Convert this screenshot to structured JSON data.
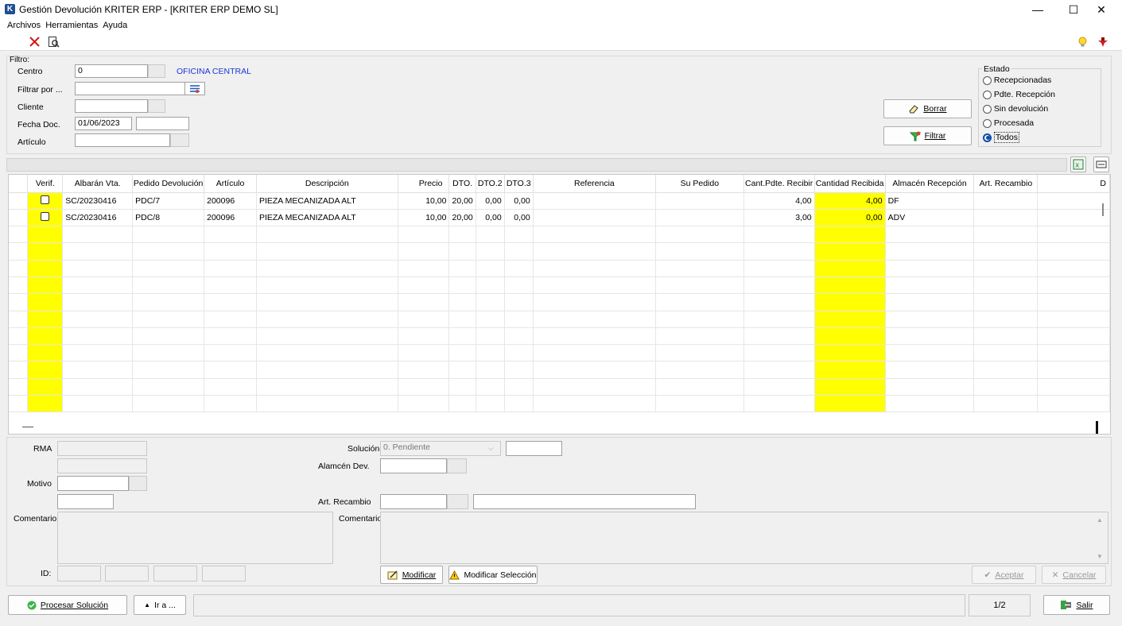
{
  "window": {
    "title": "Gestión Devolución KRITER ERP -  [KRITER ERP DEMO SL]",
    "logo": "K",
    "minimize": "—",
    "maximize": "☐",
    "close": "✕"
  },
  "menu": [
    "Archivos",
    "Herramientas",
    "Ayuda"
  ],
  "filter": {
    "title": "Filtro:",
    "centro_label": "Centro",
    "centro_value": "0",
    "centro_name": "OFICINA CENTRAL",
    "filtrar_label": "Filtrar por ...",
    "cliente_label": "Cliente",
    "fecha_label": "Fecha Doc.",
    "fecha_value": "01/06/2023",
    "articulo_label": "Artículo",
    "borrar": "Borrar",
    "filtrar": "Filtrar"
  },
  "estado": {
    "title": "Estado",
    "options": [
      "Recepcionadas",
      "Pdte. Recepción",
      "Sin devolución",
      "Procesada",
      "Todos"
    ],
    "selected": "Todos"
  },
  "grid": {
    "columns": [
      "",
      "Verif.",
      "Albarán Vta.",
      "Pedido Devolución",
      "Artículo",
      "Descripción",
      "Precio",
      "DTO.",
      "DTO.2",
      "DTO.3",
      "Referencia",
      "Su Pedido",
      "Cant.Pdte. Recibir",
      "Cantidad Recibida",
      "Almacén Recepción",
      "Art. Recambio",
      "D"
    ],
    "rows": [
      {
        "albaran": "SC/20230416",
        "pedido": "PDC/7",
        "articulo": "200096",
        "descripcion": "PIEZA MECANIZADA ALT",
        "precio": "10,00",
        "dto": "20,00",
        "dto2": "0,00",
        "dto3": "0,00",
        "referencia": "",
        "su_pedido": "",
        "pdte": "4,00",
        "recibida": "4,00",
        "almacen": "DF",
        "recambio": ""
      },
      {
        "albaran": "SC/20230416",
        "pedido": "PDC/8",
        "articulo": "200096",
        "descripcion": "PIEZA MECANIZADA ALT",
        "precio": "10,00",
        "dto": "20,00",
        "dto2": "0,00",
        "dto3": "0,00",
        "referencia": "",
        "su_pedido": "",
        "pdte": "3,00",
        "recibida": "0,00",
        "almacen": "ADV",
        "recambio": ""
      }
    ],
    "empty_rows": 11
  },
  "detail": {
    "rma_label": "RMA",
    "motivo_label": "Motivo",
    "comentario_label": "Comentario",
    "id_label": "ID:",
    "solucion_label": "Solución",
    "solucion_value": "0. Pendiente",
    "almacen_dev_label": "Alamcén Dev.",
    "art_recambio_label": "Art. Recambio",
    "comentario2_label": "Comentario",
    "modificar": "Modificar",
    "modificar_seleccion": "Modificar Selección",
    "aceptar": "Aceptar",
    "cancelar": "Cancelar"
  },
  "bottom": {
    "procesar": "Procesar Solución",
    "ir_a": "Ir a ...",
    "pages": "1/2",
    "salir": "Salir"
  },
  "colors": {
    "highlight": "#ffff00",
    "link_blue": "#1a35d8",
    "close_red": "#d11a1a"
  }
}
